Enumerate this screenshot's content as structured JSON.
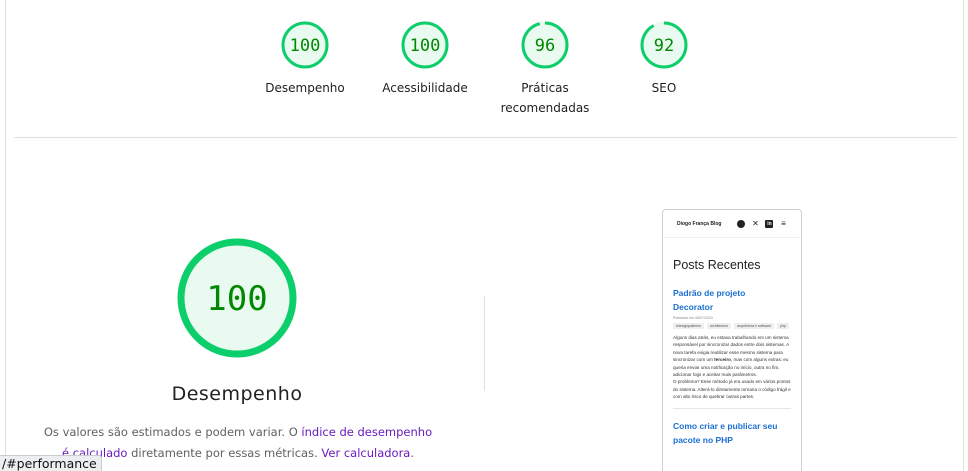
{
  "colors": {
    "pass_green": "#0cce6b",
    "pass_fill": "#e9fbf0",
    "score_text": "#008800",
    "link": "#6a1bbf"
  },
  "gauges": [
    {
      "score": "100",
      "score_value": 100,
      "label_line1": "Desempenho",
      "label_line2": ""
    },
    {
      "score": "100",
      "score_value": 100,
      "label_line1": "Acessibilidade",
      "label_line2": ""
    },
    {
      "score": "96",
      "score_value": 96,
      "label_line1": "Práticas",
      "label_line2": "recomendadas"
    },
    {
      "score": "92",
      "score_value": 92,
      "label_line1": "SEO",
      "label_line2": ""
    }
  ],
  "performance": {
    "score": "100",
    "score_value": 100,
    "title": "Desempenho",
    "desc_part1": "Os valores são estimados e podem variar. O ",
    "desc_link1": "índice de desempenho é calculado",
    "desc_part2": " diretamente por essas métricas. ",
    "desc_link2": "Ver calculadora",
    "desc_part3": "."
  },
  "phone": {
    "brand": "Diogo França Blog",
    "icons": [
      "github-icon",
      "x-icon",
      "linkedin-icon",
      "menu-icon"
    ],
    "heading": "Posts Recentes",
    "post1_title": "Padrão de projeto Decorator",
    "post1_date": "Publicado em 08/07/2024",
    "post1_tags": [
      "#designpatterns",
      "architecture",
      "arquitetura e software",
      "php"
    ],
    "post1_text_a": "Alguns dias atrás, eu estava trabalhando em um sistema responsável por sincronizar dados entre dois sistemas. A nova tarefa exigia reutilizar esse mesmo sistema para sincronizar com um ",
    "post1_text_bold": "terceiro",
    "post1_text_b": ", mas com alguns extras: eu queria enviar uma notificação no início, outra no fim, adicionar logs e aceitar mais parâmetros.",
    "post1_text_c": "O problema? Esse método já era usado em vários pontos do sistema. Alterá-lo diretamente tornaria o código frágil e com alto risco de quebrar outras partes.",
    "post2_title": "Como criar e publicar seu pacote no PHP"
  },
  "status_bar": "/#performance"
}
